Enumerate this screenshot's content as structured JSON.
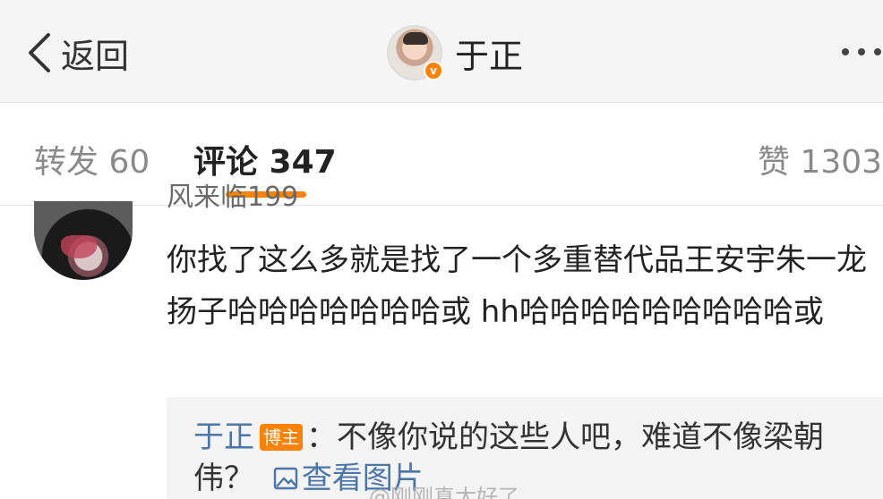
{
  "header": {
    "back_label": "返回",
    "title": "于正"
  },
  "tabs": {
    "repost": "转发 60",
    "comment": "评论 347",
    "like": "赞 1303"
  },
  "comment": {
    "username": "风来临199",
    "text": "你找了这么多就是找了一个多重替代品王安宇朱一龙扬子哈哈哈哈哈哈哈或 hh哈哈哈哈哈哈哈哈哈或"
  },
  "reply": {
    "author": "于正",
    "badge": "博主",
    "text": "：不像你说的这些人吧，难道不像梁朝伟？",
    "view_picture": "查看图片"
  },
  "watermark": "@刚刚真太好了",
  "colors": {
    "accent": "#ff8200",
    "link": "#4a76a8"
  },
  "icons": [
    "back-chevron-icon",
    "verified-badge-icon",
    "more-dots-icon",
    "picture-icon"
  ]
}
